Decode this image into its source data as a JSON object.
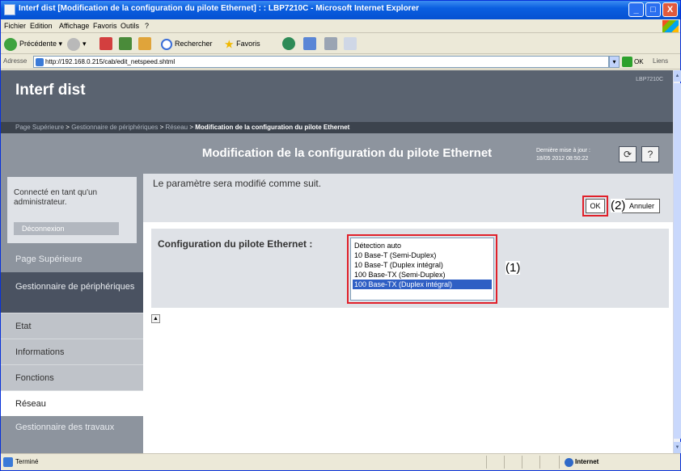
{
  "window": {
    "title": "Interf dist [Modification de la configuration du pilote Ethernet] : : LBP7210C - Microsoft Internet Explorer",
    "controls": [
      "_",
      "□",
      "X"
    ]
  },
  "menu": [
    "Fichier",
    "Edition",
    "Affichage",
    "Favoris",
    "Outils",
    "?"
  ],
  "toolbar": {
    "back_label": "Précédente",
    "search_label": "Rechercher",
    "favorites_label": "Favoris"
  },
  "address": {
    "label": "Adresse",
    "url": "http://192.168.0.215/cab/edit_netspeed.shtml",
    "go_label": "OK",
    "links_label": "Liens"
  },
  "page": {
    "brand": "Interf dist",
    "model": "LBP7210C",
    "breadcrumb": {
      "item1": "Page Supérieure",
      "sep1": ">",
      "item2": "Gestionnaire de périphériques",
      "sep2": ">",
      "item3": "Réseau",
      "sep3": ">",
      "current": "Modification de la configuration du pilote Ethernet"
    },
    "title": "Modification de la configuration du pilote Ethernet",
    "last_update": "Dernière mise à jour : 18/05 2012 08:50:22",
    "refresh_icon": "refresh-icon",
    "help_label": "?"
  },
  "sidebar": {
    "login_text": "Connecté en tant qu'un administrateur.",
    "logout_label": "Déconnexion",
    "nav_top": "Page Supérieure",
    "nav_selected": "Gestionnaire de périphériques",
    "sub_items": [
      "Etat",
      "Informations",
      "Fonctions",
      "Réseau"
    ],
    "active_sub": "Réseau",
    "nav_jobs": "Gestionnaire des travaux"
  },
  "main": {
    "message": "Le paramètre sera modifié comme suit.",
    "ok_label": "OK",
    "cancel_label": "Annuler",
    "field_label": "Configuration du pilote Ethernet :",
    "options": [
      "Détection auto",
      "10 Base-T (Semi-Duplex)",
      "10 Base-T (Duplex intégral)",
      "100 Base-TX (Semi-Duplex)",
      "100 Base-TX (Duplex intégral)"
    ],
    "selected_option": "100 Base-TX (Duplex intégral)",
    "callout_1": "(1)",
    "callout_2": "(2)",
    "highlight_color": "#e0202a"
  },
  "status": {
    "text": "Terminé",
    "zone": "Internet"
  }
}
